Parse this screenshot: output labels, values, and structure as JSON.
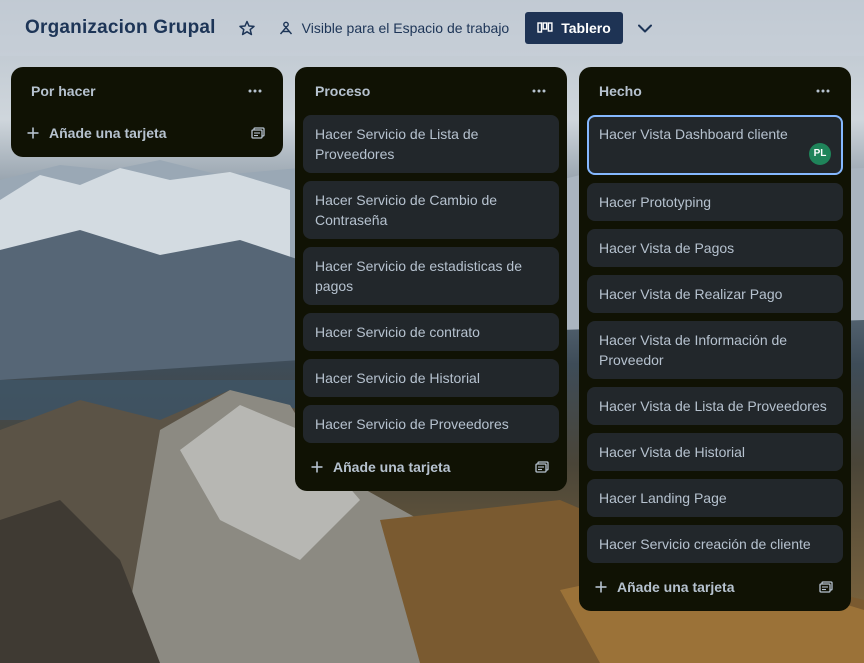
{
  "header": {
    "title": "Organizacion Grupal",
    "visibility_label": "Visible para el Espacio de trabajo",
    "view_label": "Tablero"
  },
  "lists": [
    {
      "title": "Por hacer",
      "cards": [],
      "add_label": "Añade una tarjeta"
    },
    {
      "title": "Proceso",
      "cards": [
        "Hacer Servicio de Lista de Proveedores",
        "Hacer Servicio de Cambio de Contraseña",
        "Hacer Servicio de estadisticas de pagos",
        "Hacer Servicio de contrato",
        "Hacer Servicio de Historial",
        "Hacer Servicio de Proveedores"
      ],
      "add_label": "Añade una tarjeta"
    },
    {
      "title": "Hecho",
      "cards": [
        "Hacer Vista Dashboard cliente",
        "Hacer Prototyping",
        "Hacer Vista de Pagos",
        "Hacer Vista de Realizar Pago",
        "Hacer Vista de Información de Proveedor",
        "Hacer Vista de Lista de Proveedores",
        "Hacer Vista de Historial",
        "Hacer Landing Page",
        "Hacer Servicio creación de cliente"
      ],
      "add_label": "Añade una tarjeta",
      "first_card_member": "PL"
    }
  ],
  "colors": {
    "header_text": "#1d3557",
    "view_button_bg": "#1e3354",
    "list_bg": "#101204",
    "card_bg": "#22272b",
    "card_text": "#b6c2cf",
    "selected_border": "#85b8ff",
    "avatar_bg": "#1f845a"
  },
  "icons": {
    "star": "star-icon",
    "visibility": "workspace-visibility-icon",
    "board_view": "board-view-icon",
    "chevron": "chevron-down-icon",
    "list_menu": "more-horizontal-icon",
    "add": "plus-icon",
    "template": "card-template-icon"
  }
}
